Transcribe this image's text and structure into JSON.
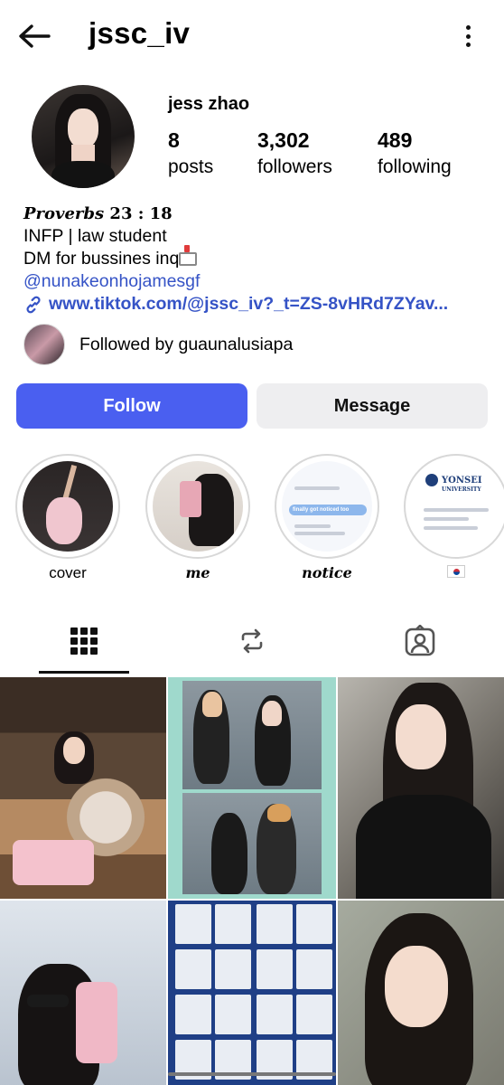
{
  "header": {
    "username": "jssc_iv",
    "back_icon": "arrow-left-icon",
    "more_icon": "more-vertical-icon"
  },
  "profile": {
    "display_name": "jess zhao",
    "stats": [
      {
        "value": "8",
        "label": "posts"
      },
      {
        "value": "3,302",
        "label": "followers"
      },
      {
        "value": "489",
        "label": "following"
      }
    ],
    "bio": {
      "verse_word": "Proverbs",
      "verse_ref": "23 : 18",
      "line1": "INFP | law student",
      "line2": "DM for bussines inq",
      "mention": "@nunakeonhojamesgf",
      "link": "www.tiktok.com/@jssc_iv?_t=ZS-8vHRd7ZYav..."
    },
    "followed_by": "Followed by guaunalusiapa"
  },
  "actions": {
    "follow": "Follow",
    "message": "Message",
    "follow_color": "#4a5ff0"
  },
  "highlights": [
    {
      "caption": "cover"
    },
    {
      "caption": "me"
    },
    {
      "caption": "notice"
    },
    {
      "caption": "",
      "icon": "south-korea-flag-icon"
    }
  ],
  "highlight_text": {
    "notice_pill": "finally got noticed too",
    "yonsei": "YONSEI",
    "university": "UNIVERSITY"
  },
  "tabs": [
    {
      "name": "posts-grid",
      "icon": "grid-icon"
    },
    {
      "name": "reposts",
      "icon": "repost-icon"
    },
    {
      "name": "tagged",
      "icon": "tagged-person-icon"
    }
  ]
}
